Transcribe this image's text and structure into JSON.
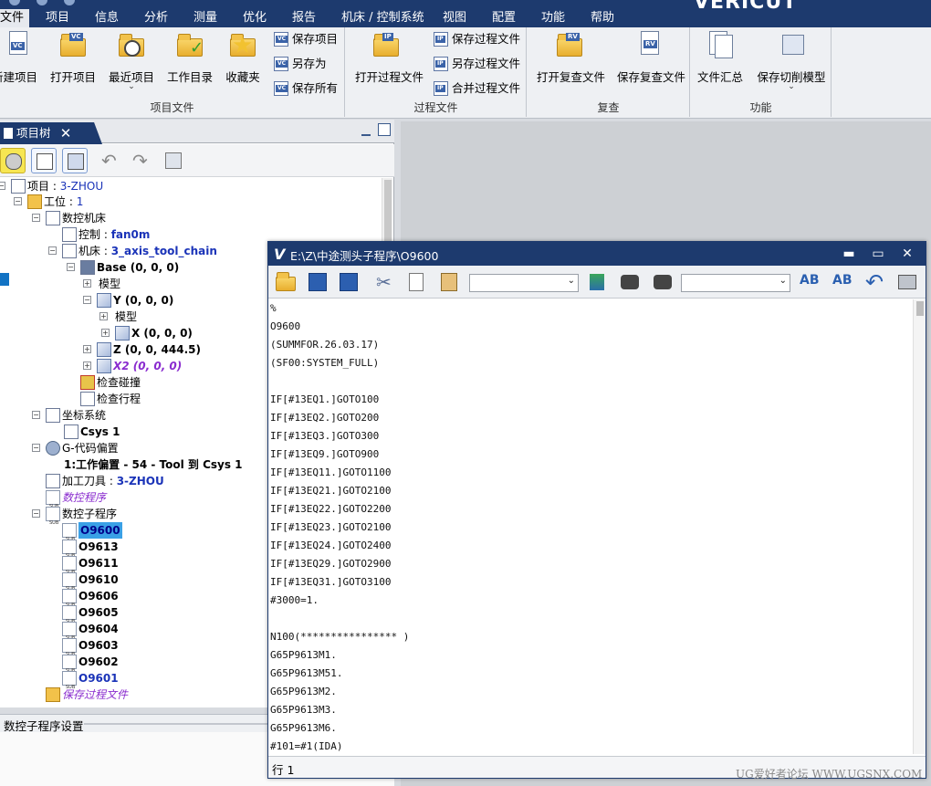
{
  "app": {
    "brand": "VERICUT"
  },
  "menu": [
    {
      "label": "文件",
      "active": true
    },
    {
      "label": "项目"
    },
    {
      "label": "信息"
    },
    {
      "label": "分析"
    },
    {
      "label": "测量"
    },
    {
      "label": "优化"
    },
    {
      "label": "报告"
    },
    {
      "label": "机床 / 控制系统"
    },
    {
      "label": "视图"
    },
    {
      "label": "配置"
    },
    {
      "label": "功能"
    },
    {
      "label": "帮助"
    }
  ],
  "ribbon": {
    "groups": {
      "project": "项目文件",
      "process": "过程文件",
      "review": "复查",
      "function": "功能"
    },
    "project_buttons": {
      "new": "新建项目",
      "open": "打开项目",
      "recent": "最近项目",
      "workdir": "工作目录",
      "favorites": "收藏夹",
      "save": "保存项目",
      "save_as": "另存为",
      "save_all": "保存所有"
    },
    "process_buttons": {
      "open": "打开过程文件",
      "save": "保存过程文件",
      "save_as": "另存过程文件",
      "merge": "合并过程文件"
    },
    "review_buttons": {
      "open": "打开复查文件",
      "save": "保存复查文件"
    },
    "function_buttons": {
      "summary": "文件汇总",
      "save_cut": "保存切削模型"
    },
    "arrow": "⌄"
  },
  "panel": {
    "tab": "项目树",
    "close": "✕"
  },
  "tree": {
    "project_label": "项目 : ",
    "project_name": "3-ZHOU",
    "setup_label": "工位 : ",
    "setup_name": "1",
    "cnc_machine": "数控机床",
    "control_label": "控制 : ",
    "control_name": "fan0m",
    "machine_label": "机床 : ",
    "machine_name": "3_axis_tool_chain",
    "base": "Base (0, 0, 0)",
    "model1": "模型",
    "y_axis": "Y (0, 0, 0)",
    "model2": "模型",
    "x_axis": "X (0, 0, 0)",
    "z_axis": "Z (0, 0, 444.5)",
    "x2_axis": "X2 (0, 0, 0)",
    "collision": "检查碰撞",
    "travel": "检查行程",
    "coord_sys": "坐标系统",
    "csys": "Csys 1",
    "gcode_offsets": "G-代码偏置",
    "work_offset": "1:工作偏置 - 54 - Tool 到 Csys 1",
    "tool_label": "加工刀具 : ",
    "tool_name": "3-ZHOU",
    "nc_program": "数控程序",
    "nc_sub": "数控子程序",
    "subs": [
      "O9600",
      "O9613",
      "O9611",
      "O9610",
      "O9606",
      "O9605",
      "O9604",
      "O9603",
      "O9602",
      "O9601"
    ],
    "save_process": "保存过程文件"
  },
  "status": {
    "panel_status": "数控子程序设置"
  },
  "editor": {
    "logo": "V",
    "title": "E:\\Z\\中途测头子程序\\O9600",
    "minimize": "▬",
    "maximize": "▭",
    "close": "✕",
    "status": "行 1",
    "lines": [
      "%",
      "O9600",
      "(SUMMFOR.26.03.17)",
      "(SF00:SYSTEM_FULL)",
      "",
      "IF[#13EQ1.]GOTO100",
      "IF[#13EQ2.]GOTO200",
      "IF[#13EQ3.]GOTO300",
      "IF[#13EQ9.]GOTO900",
      "IF[#13EQ11.]GOTO1100",
      "IF[#13EQ21.]GOTO2100",
      "IF[#13EQ22.]GOTO2200",
      "IF[#13EQ23.]GOTO2100",
      "IF[#13EQ24.]GOTO2400",
      "IF[#13EQ29.]GOTO2900",
      "IF[#13EQ31.]GOTO3100",
      "#3000=1.",
      "",
      "N100(**************** )",
      "G65P9613M1.",
      "G65P9613M51.",
      "G65P9613M2.",
      "G65P9613M3.",
      "G65P9613M6.",
      "#101=#1(IDA)"
    ]
  },
  "watermark": "UG爱好者论坛 WWW.UGSNX.COM",
  "colors": {
    "title_bar": "#1d3a6e",
    "selection": "#3aa0e6",
    "italic_item": "#8a2ccf",
    "link_blue": "#1a33b8"
  }
}
